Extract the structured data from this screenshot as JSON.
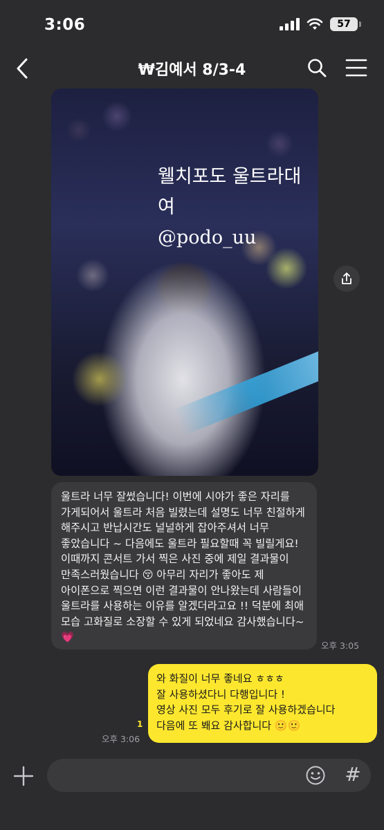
{
  "status_bar": {
    "time": "3:06",
    "battery": "57"
  },
  "nav": {
    "title": "₩김예서 8/3-4"
  },
  "photo": {
    "watermark_line1": "웰치포도 울트라대여",
    "watermark_line2": "@podo_uu"
  },
  "messages": {
    "incoming": {
      "text": "울트라 너무 잘썼습니다! 이번에 시야가 좋은 자리를 가게되어서 울트라 처음 빌렸는데 설명도 너무 친절하게 해주시고 반납시간도 널널하게 잡아주셔서 너무 좋았습니다 ~ 다음에도 울트라 필요할때 꼭 빌릴게요! 이때까지 콘서트 가서 찍은 사진 중에 제일 결과물이 만족스러웠습니다 😚 아무리 자리가 좋아도 제 아이폰으로 찍으면 이런 결과물이 안나왔는데 사람들이 울트라를 사용하는 이유를 알겠더라고요 !! 덕분에 최애 모습 고화질로 소장할 수 있게 되었네요 감사했습니다~💗",
      "time": "오후 3:05"
    },
    "outgoing": {
      "lines": [
        "와 화질이 너무 좋네요 ㅎㅎㅎ",
        "잘 사용하셨다니 다행입니다 !",
        "영상 사진 모두 후기로 잘 사용하겠습니다",
        "다음에 또 봬요 감사합니다 🙂🙂"
      ],
      "read_count": "1",
      "time": "오후 3:06"
    }
  },
  "input": {
    "hash_label": "#"
  },
  "colors": {
    "background": "#2c2c2e",
    "incoming_bubble": "#3a3a3c",
    "outgoing_bubble": "#fde72e"
  },
  "icons": [
    "back-icon",
    "search-icon",
    "menu-icon",
    "share-icon",
    "plus-icon",
    "emoji-icon"
  ]
}
